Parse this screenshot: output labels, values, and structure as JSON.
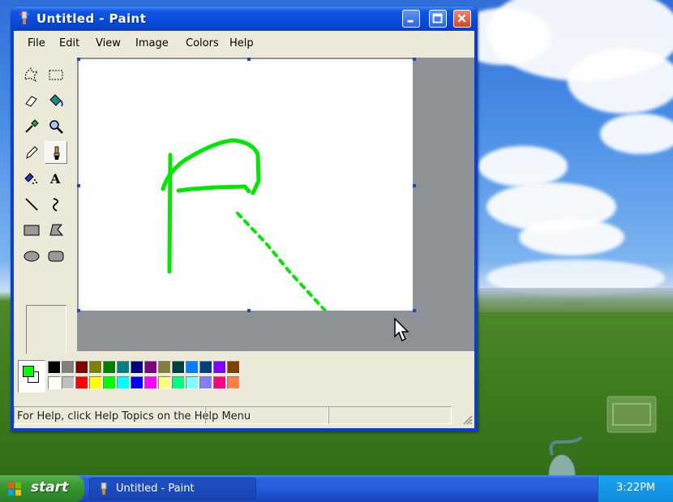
{
  "window": {
    "title": "Untitled - Paint",
    "icon": "paint-icon",
    "buttons": [
      "minimize-icon",
      "maximize-icon",
      "close-icon"
    ]
  },
  "menu": {
    "file": "File",
    "edit": "Edit",
    "view": "View",
    "image": "Image",
    "colors": "Colors",
    "help": "Help"
  },
  "tools": [
    {
      "name": "free-form-select-icon"
    },
    {
      "name": "select-icon"
    },
    {
      "name": "eraser-icon"
    },
    {
      "name": "fill-icon"
    },
    {
      "name": "pick-color-icon"
    },
    {
      "name": "magnifier-icon"
    },
    {
      "name": "pencil-icon"
    },
    {
      "name": "brush-icon",
      "selected": true
    },
    {
      "name": "airbrush-icon"
    },
    {
      "name": "text-icon"
    },
    {
      "name": "line-icon"
    },
    {
      "name": "curve-icon"
    },
    {
      "name": "rectangle-icon"
    },
    {
      "name": "polygon-icon"
    },
    {
      "name": "ellipse-icon"
    },
    {
      "name": "rounded-rectangle-icon"
    }
  ],
  "palette": {
    "foreground": "#00ff00",
    "background": "#ffffff",
    "row1": [
      "#000000",
      "#808080",
      "#800000",
      "#808000",
      "#008000",
      "#008080",
      "#000080",
      "#800080",
      "#808040",
      "#004040",
      "#0080ff",
      "#004080",
      "#8000ff",
      "#804000"
    ],
    "row2": [
      "#ffffff",
      "#c0c0c0",
      "#ff0000",
      "#ffff00",
      "#00ff00",
      "#00ffff",
      "#0000ff",
      "#ff00ff",
      "#ffff80",
      "#00ff80",
      "#80ffff",
      "#8080ff",
      "#ff0080",
      "#ff8040"
    ]
  },
  "status": {
    "help_text": "For Help, click Help Topics on the Help Menu"
  },
  "taskbar": {
    "start_label": "start",
    "task_label": "Untitled - Paint",
    "clock": "3:22PM"
  },
  "drawing": {
    "stroke_color": "#00ff00"
  }
}
